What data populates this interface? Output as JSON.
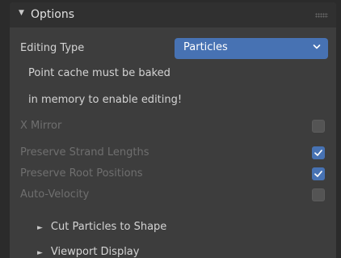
{
  "panel": {
    "title": "Options",
    "expanded": true,
    "editing_type": {
      "label": "Editing Type",
      "value": "Particles"
    },
    "info_lines": [
      "Point cache must be baked",
      "in memory to enable editing!"
    ],
    "x_mirror": {
      "label": "X Mirror",
      "checked": false,
      "enabled": false
    },
    "preserve_strand_lengths": {
      "label": "Preserve Strand Lengths",
      "checked": true,
      "enabled": true
    },
    "preserve_root_positions": {
      "label": "Preserve Root Positions",
      "checked": true,
      "enabled": true
    },
    "auto_velocity": {
      "label": "Auto-Velocity",
      "checked": false,
      "enabled": false
    },
    "subpanels": [
      {
        "label": "Cut Particles to Shape",
        "expanded": false
      },
      {
        "label": "Viewport Display",
        "expanded": false
      }
    ]
  },
  "colors": {
    "accent": "#4772b3",
    "panel_bg": "#3d3d3d",
    "header_bg": "#303030",
    "text": "#d4d4d4",
    "disabled_text": "#6f6f6f"
  }
}
